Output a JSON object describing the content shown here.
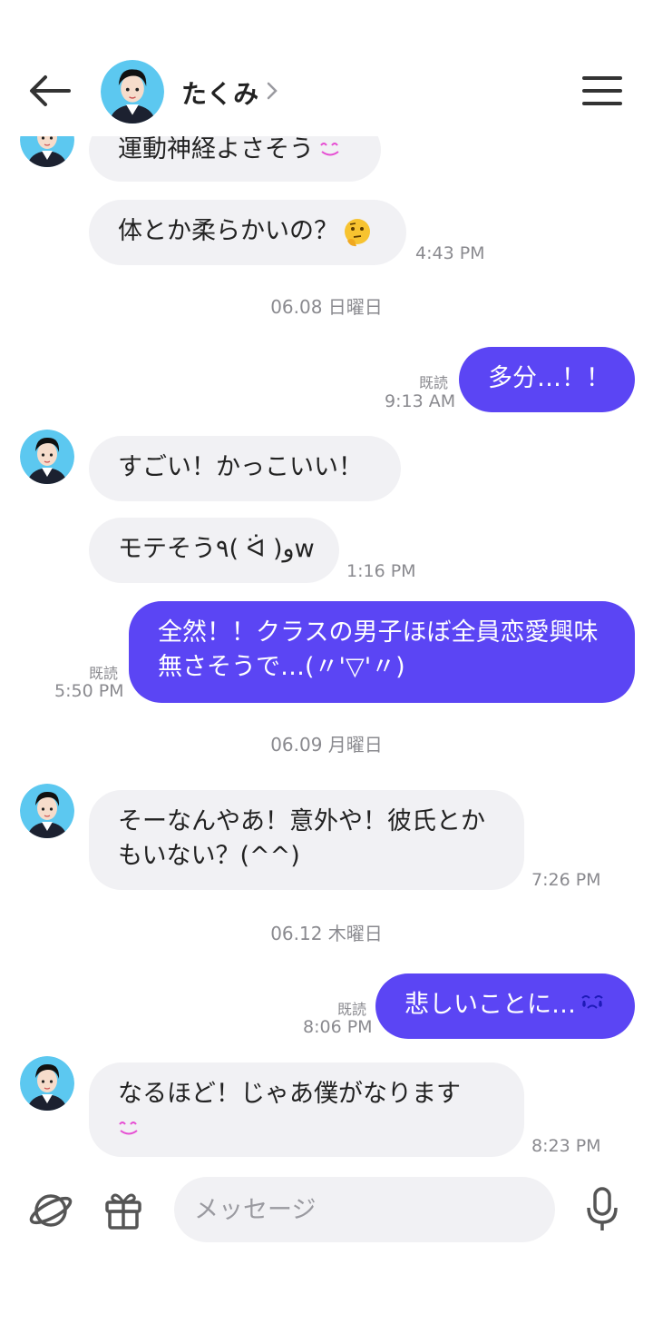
{
  "header": {
    "contact_name": "たくみ"
  },
  "messages": [
    {
      "id": 1,
      "dir": "in",
      "text": "運動神経よさそう",
      "emoji": "smile-icon"
    },
    {
      "id": 2,
      "dir": "in",
      "text": "体とか柔らかいの？",
      "emoji": "thinking-face-icon",
      "time": "4:43 PM"
    },
    {
      "id": 3,
      "dir": "date",
      "text": "06.08 日曜日"
    },
    {
      "id": 4,
      "dir": "out",
      "text": "多分…！！",
      "read": "既読",
      "time": "9:13 AM"
    },
    {
      "id": 5,
      "dir": "in",
      "text": "すごい！かっこいい！"
    },
    {
      "id": 6,
      "dir": "in",
      "text": "モテそう٩( ᐛ )وw",
      "time": "1:16 PM"
    },
    {
      "id": 7,
      "dir": "out",
      "text": "全然！！クラスの男子ほぼ全員恋愛興味無さそうで…(〃'▽'〃)",
      "read": "既読",
      "time": "5:50 PM"
    },
    {
      "id": 8,
      "dir": "date",
      "text": "06.09 月曜日"
    },
    {
      "id": 9,
      "dir": "in",
      "text": "そーなんやあ！意外や！彼氏とかもいない？(^^)",
      "time": "7:26 PM"
    },
    {
      "id": 10,
      "dir": "date",
      "text": "06.12 木曜日"
    },
    {
      "id": 11,
      "dir": "out",
      "text": "悲しいことに…",
      "emoji": "crying-icon",
      "read": "既読",
      "time": "8:06 PM"
    },
    {
      "id": 12,
      "dir": "in",
      "text": "なるほど！じゃあ僕がなります",
      "emoji": "smile-icon",
      "time": "8:23 PM"
    }
  ],
  "composer": {
    "placeholder": "メッセージ"
  },
  "colors": {
    "outgoing_bubble": "#5b45f4",
    "incoming_bubble": "#f1f1f4",
    "secondary_text": "#8a8a8f"
  }
}
